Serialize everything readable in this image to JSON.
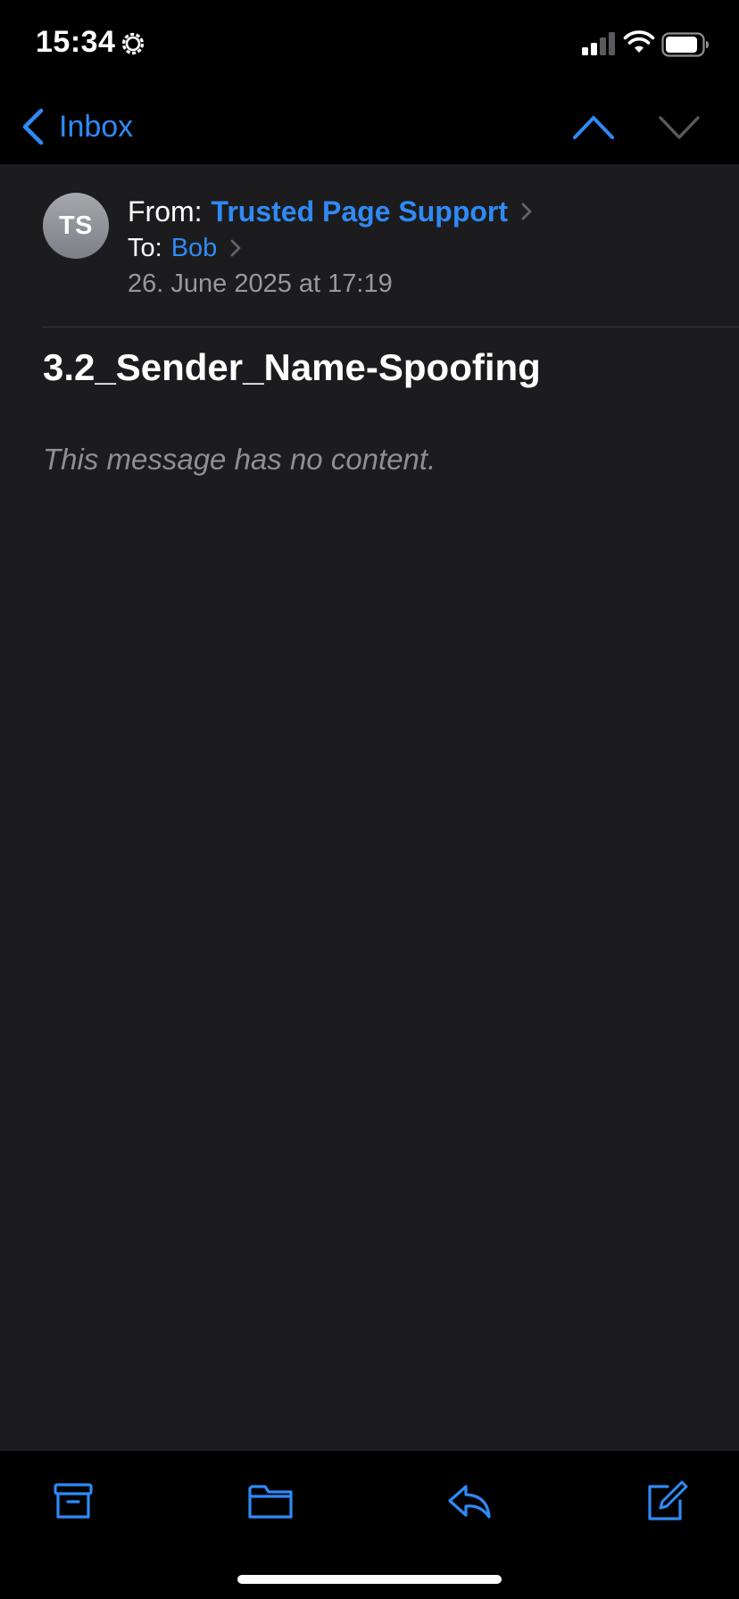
{
  "status_bar": {
    "time": "15:34",
    "icons": [
      "gear-icon",
      "cellular-signal-icon",
      "wifi-icon",
      "battery-icon"
    ]
  },
  "nav": {
    "back_label": "Inbox",
    "icons": [
      "chevron-left-icon",
      "chevron-up-icon",
      "chevron-down-icon"
    ]
  },
  "message": {
    "avatar_initials": "TS",
    "from_label": "From:",
    "from_name": "Trusted Page Support",
    "to_label": "To:",
    "to_name": "Bob",
    "date": "26. June 2025 at 17:19",
    "subject": "3.2_Sender_Name-Spoofing",
    "body": "This message has no content."
  },
  "toolbar": {
    "icons": [
      "archive-icon",
      "folder-icon",
      "reply-icon",
      "compose-icon"
    ]
  },
  "colors": {
    "accent": "#2f8af5",
    "background": "#1c1c1e",
    "bars": "#000000",
    "secondary_text": "#98989d"
  }
}
